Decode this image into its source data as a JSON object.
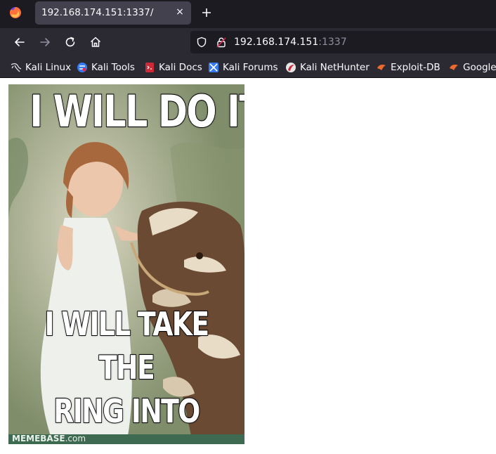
{
  "tab": {
    "title": "192.168.174.151:1337/",
    "close_symbol": "×"
  },
  "navbar": {
    "url_host": "192.168.174.151",
    "url_port": ":1337",
    "icons": [
      "back-arrow-icon",
      "forward-arrow-icon",
      "reload-icon",
      "home-icon",
      "shield-icon",
      "not-secure-lock-icon"
    ]
  },
  "bookmarks": [
    {
      "label": "Kali Linux",
      "icon": "kali-dragon-icon"
    },
    {
      "label": "Kali Tools",
      "icon": "kali-tools-icon"
    },
    {
      "label": "Kali Docs",
      "icon": "kali-docs-icon"
    },
    {
      "label": "Kali Forums",
      "icon": "kali-forums-icon"
    },
    {
      "label": "Kali NetHunter",
      "icon": "nethunter-icon"
    },
    {
      "label": "Exploit-DB",
      "icon": "exploit-db-icon"
    },
    {
      "label": "Google",
      "icon": "google-icon"
    }
  ],
  "meme": {
    "top_text": "I WILL DO IT",
    "bottom_text": "I WILL TAKE THE\nRING INTO\nMORDOR",
    "footer_brand": "MEMEBASE",
    "footer_domain": ".com"
  },
  "colors": {
    "tabstrip_bg": "#1c1b22",
    "toolbar_bg": "#2b2a33",
    "active_tab_bg": "#42414d",
    "text_light": "#fbfbfe",
    "url_port_gray": "#8f8f9d",
    "meme_footer_green": "#3e6a52"
  }
}
